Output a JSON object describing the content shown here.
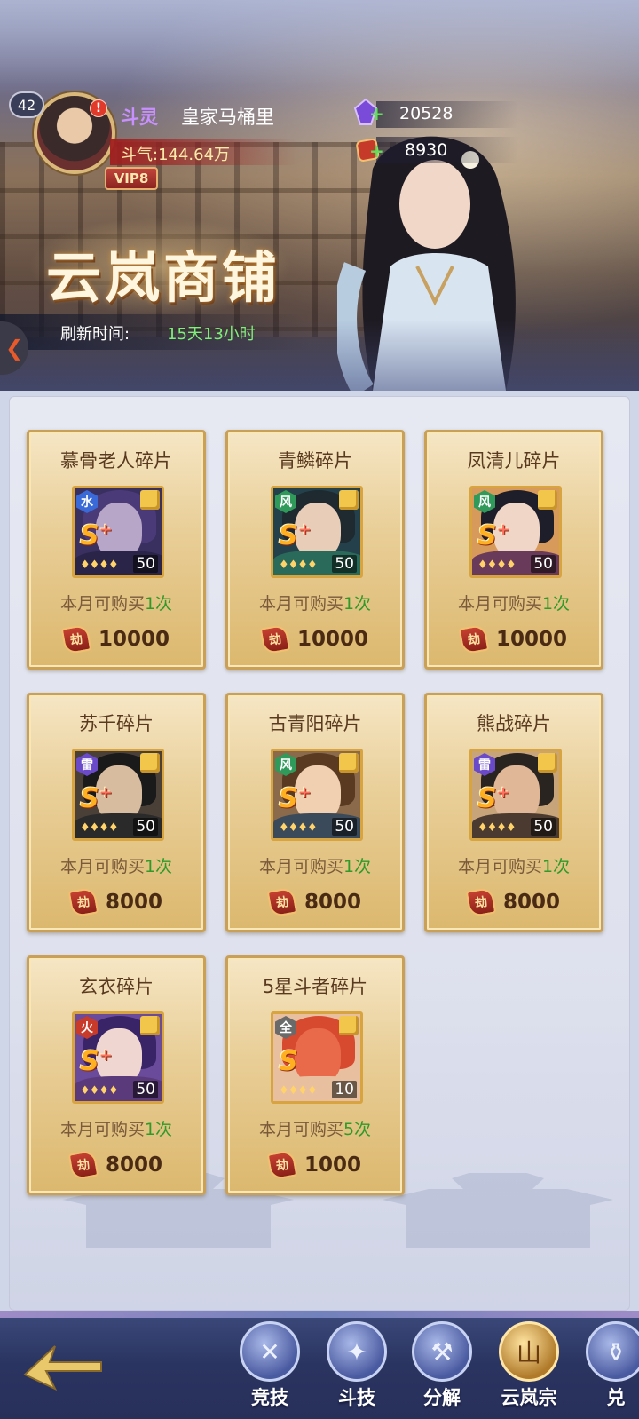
{
  "player": {
    "level": "42",
    "alert": "!",
    "rank": "斗灵",
    "name": "皇家马桶里",
    "power": "斗气:144.64万",
    "vip": "VIP8"
  },
  "currencies": [
    {
      "icon": "purple-crystal-icon",
      "value": "20528"
    },
    {
      "icon": "shop-token-icon",
      "value": "8930"
    }
  ],
  "shop": {
    "title": "云岚商铺",
    "refresh_label": "刷新时间:",
    "refresh_value": "15天13小时"
  },
  "items": [
    {
      "title": "慕骨老人碎片",
      "element": "水",
      "element_color": "#3a6ad8",
      "grade": "S",
      "plus": "+",
      "count": "50",
      "limit_prefix": "本月可购买",
      "limit_count": "1次",
      "price": "10000",
      "portrait": {
        "bg": "#3a3060",
        "hair": "#4a3a78",
        "face": "#b8a6c8",
        "shoulder": "#2a2448"
      }
    },
    {
      "title": "青鳞碎片",
      "element": "风",
      "element_color": "#2f9a5a",
      "grade": "S",
      "plus": "+",
      "count": "50",
      "limit_prefix": "本月可购买",
      "limit_count": "1次",
      "price": "10000",
      "portrait": {
        "bg": "#24404a",
        "hair": "#1e2a30",
        "face": "#e8cdb8",
        "shoulder": "#2a6a5a"
      }
    },
    {
      "title": "凤清儿碎片",
      "element": "风",
      "element_color": "#2f9a5a",
      "grade": "S",
      "plus": "+",
      "count": "50",
      "limit_prefix": "本月可购买",
      "limit_count": "1次",
      "price": "10000",
      "portrait": {
        "bg": "#d89a5a",
        "hair": "#1e1e2a",
        "face": "#f0d6c6",
        "shoulder": "#6a3a5a"
      }
    },
    {
      "title": "苏千碎片",
      "element": "雷",
      "element_color": "#6a4ac8",
      "grade": "S",
      "plus": "+",
      "count": "50",
      "limit_prefix": "本月可购买",
      "limit_count": "1次",
      "price": "8000",
      "portrait": {
        "bg": "#4a4038",
        "hair": "#1a1a1a",
        "face": "#d8bca0",
        "shoulder": "#2a2a2a"
      }
    },
    {
      "title": "古青阳碎片",
      "element": "风",
      "element_color": "#2f9a5a",
      "grade": "S",
      "plus": "+",
      "count": "50",
      "limit_prefix": "本月可购买",
      "limit_count": "1次",
      "price": "8000",
      "portrait": {
        "bg": "#8a6a4a",
        "hair": "#5a3a20",
        "face": "#f0d0b0",
        "shoulder": "#3a4a5a"
      }
    },
    {
      "title": "熊战碎片",
      "element": "雷",
      "element_color": "#6a4ac8",
      "grade": "S",
      "plus": "+",
      "count": "50",
      "limit_prefix": "本月可购买",
      "limit_count": "1次",
      "price": "8000",
      "portrait": {
        "bg": "#c8a47a",
        "hair": "#2a2420",
        "face": "#e0b898",
        "shoulder": "#4a3a30"
      }
    },
    {
      "title": "玄衣碎片",
      "element": "火",
      "element_color": "#c83a2a",
      "grade": "S",
      "plus": "+",
      "count": "50",
      "limit_prefix": "本月可购买",
      "limit_count": "1次",
      "price": "8000",
      "portrait": {
        "bg": "#6a4a9a",
        "hair": "#3a2468",
        "face": "#f0d6d0",
        "shoulder": "#5a3a7a"
      }
    },
    {
      "title": "5星斗者碎片",
      "element": "全",
      "element_color": "#6a6a6a",
      "grade": "S",
      "plus": "",
      "count": "10",
      "limit_prefix": "本月可购买",
      "limit_count": "5次",
      "price": "1000",
      "portrait": {
        "bg": "#e8c0a0",
        "hair": "#d84a30",
        "face": "#e86a4a",
        "shoulder": "#e8c0a0"
      }
    }
  ],
  "nav": [
    {
      "label": "竞技",
      "icon": "crossed-swords-icon",
      "glyph": "✕"
    },
    {
      "label": "斗技",
      "icon": "scroll-icon",
      "glyph": "✦"
    },
    {
      "label": "分解",
      "icon": "armor-icon",
      "glyph": "⚒"
    },
    {
      "label": "云岚宗",
      "icon": "yunlan-sect-icon",
      "glyph": "山"
    },
    {
      "label": "兑",
      "icon": "exchange-bag-icon",
      "glyph": "⚱"
    }
  ],
  "colors": {
    "accent_green": "#2f9a2a",
    "title_text": "#5a3a1e",
    "card_border": "#c9a056"
  }
}
